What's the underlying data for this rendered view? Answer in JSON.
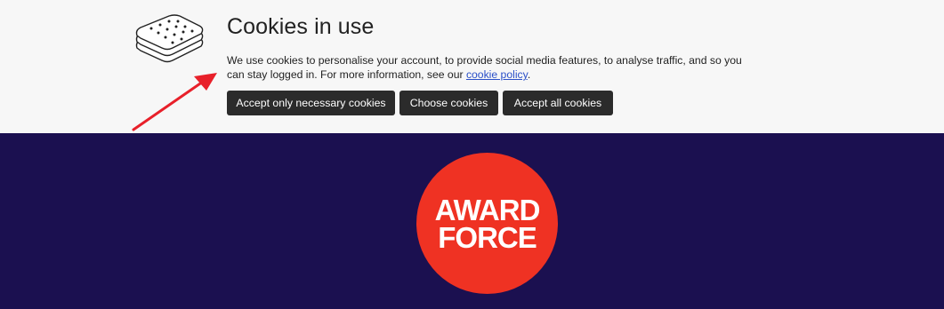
{
  "cookie_banner": {
    "title": "Cookies in use",
    "text": "We use cookies to personalise your account, to provide social media features, to analyse traffic, and so you can stay logged in. For more information, see our ",
    "policy_link": "cookie policy",
    "text_end": ".",
    "buttons": {
      "necessary": "Accept only necessary cookies",
      "choose": "Choose cookies",
      "all": "Accept all cookies"
    },
    "icon": "cookie-sandwich-icon"
  },
  "logo": {
    "line1": "AWARD",
    "line2": "FORCE"
  },
  "colors": {
    "banner_bg": "#f7f7f7",
    "page_bg": "#1b1050",
    "button_bg": "#2b2b2b",
    "link": "#2b50c8",
    "logo_red": "#ef3223",
    "annotation_arrow": "#e8202a"
  }
}
